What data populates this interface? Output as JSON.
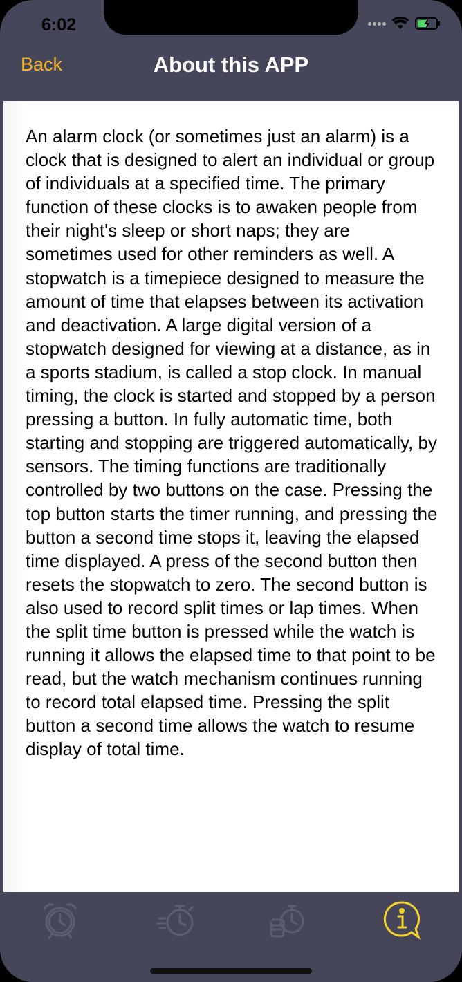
{
  "status_bar": {
    "time": "6:02"
  },
  "nav": {
    "back_label": "Back",
    "title": "About this APP"
  },
  "content": {
    "text": "An alarm clock (or sometimes just an alarm) is a clock that is designed to alert an individual or group of individuals at a specified time. The primary function of these clocks is to awaken people from their night's sleep or short naps; they are sometimes used for other reminders as well. A stopwatch is a timepiece designed to measure the amount of time that elapses between its activation and deactivation. A large digital version of a stopwatch designed for viewing at a distance, as in a sports stadium, is called a stop clock. In manual timing, the clock is started and stopped by a person pressing a button. In fully automatic time, both starting and stopping are triggered automatically, by sensors. The timing functions are traditionally controlled by two buttons on the case. Pressing the top button starts the timer running, and pressing the button a second time stops it, leaving the elapsed time displayed. A press of the second button then resets the stopwatch to zero. The second button is also used to record split times or lap times. When the split time button is pressed while the watch is running it allows the elapsed time to that point to be read, but the watch mechanism continues running to record total elapsed time. Pressing the split button a second time allows the watch to resume display of total time."
  },
  "tabbar": {
    "tabs": [
      {
        "icon": "alarm-clock-icon",
        "selected": false
      },
      {
        "icon": "stopwatch-icon",
        "selected": false
      },
      {
        "icon": "hand-stopwatch-icon",
        "selected": false
      },
      {
        "icon": "info-icon",
        "selected": true
      }
    ]
  },
  "colors": {
    "accent": "#f5b32a",
    "bar_background": "#45465a",
    "tab_inactive": "#5c5e70",
    "tab_active": "#f5d32a"
  }
}
